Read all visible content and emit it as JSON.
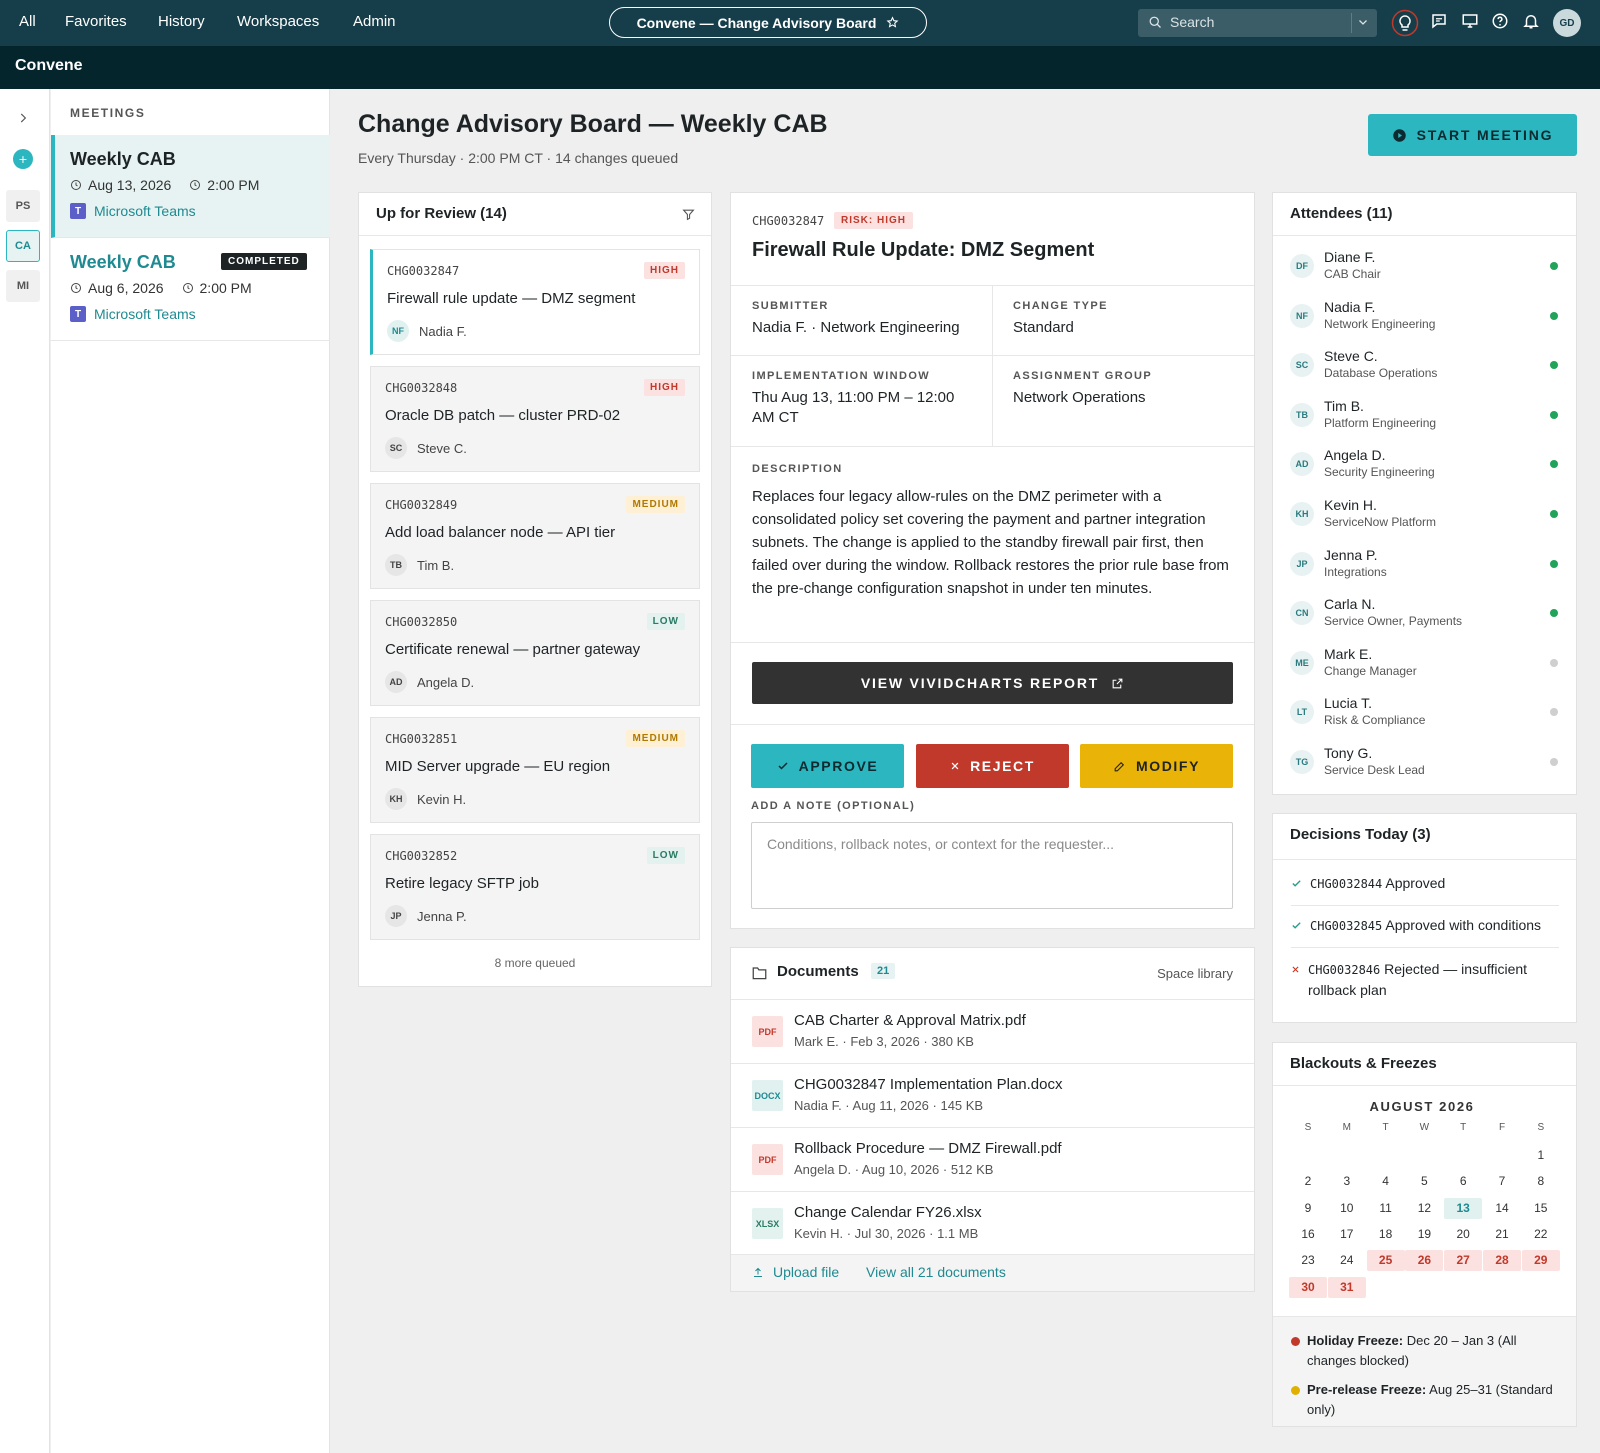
{
  "nav": {
    "items": [
      "All",
      "Favorites",
      "History",
      "Workspaces",
      "Admin"
    ],
    "workspace_title": "Convene — Change Advisory Board",
    "search_placeholder": "Search",
    "avatar_initials": "GD"
  },
  "brand": "Convene",
  "rail": {
    "items": [
      "PS",
      "CA",
      "MI"
    ],
    "active": "CA"
  },
  "meetings": {
    "label": "MEETINGS",
    "items": [
      {
        "title": "Weekly CAB",
        "date": "Aug 13, 2026",
        "time": "2:00 PM",
        "platform": "Microsoft Teams",
        "active": true
      },
      {
        "title": "Weekly CAB",
        "date": "Aug 6, 2026",
        "time": "2:00 PM",
        "platform": "Microsoft Teams",
        "status": "COMPLETED"
      }
    ]
  },
  "page": {
    "title": "Change Advisory Board — Weekly CAB",
    "subtitle": "Every Thursday · 2:00 PM CT · 14 changes queued",
    "start_button": "START MEETING"
  },
  "review": {
    "heading": "Up for Review (14)",
    "items": [
      {
        "id": "CHG0032847",
        "title": "Firewall rule update — DMZ segment",
        "risk": "HIGH",
        "initials": "NF",
        "owner": "Nadia F."
      },
      {
        "id": "CHG0032848",
        "title": "Oracle DB patch — cluster PRD-02",
        "risk": "HIGH",
        "initials": "SC",
        "owner": "Steve C."
      },
      {
        "id": "CHG0032849",
        "title": "Add load balancer node — API tier",
        "risk": "MEDIUM",
        "initials": "TB",
        "owner": "Tim B."
      },
      {
        "id": "CHG0032850",
        "title": "Certificate renewal — partner gateway",
        "risk": "LOW",
        "initials": "AD",
        "owner": "Angela D."
      },
      {
        "id": "CHG0032851",
        "title": "MID Server upgrade — EU region",
        "risk": "MEDIUM",
        "initials": "KH",
        "owner": "Kevin H."
      },
      {
        "id": "CHG0032852",
        "title": "Retire legacy SFTP job",
        "risk": "LOW",
        "initials": "JP",
        "owner": "Jenna P."
      }
    ],
    "more": "8 more queued"
  },
  "detail": {
    "id": "CHG0032847",
    "risk": "RISK: HIGH",
    "title": "Firewall Rule Update: DMZ Segment",
    "submitter_label": "SUBMITTER",
    "submitter": "Nadia F. · Network Engineering",
    "type_label": "CHANGE TYPE",
    "type": "Standard",
    "window_label": "IMPLEMENTATION WINDOW",
    "window": "Thu Aug 13, 11:00 PM – 12:00 AM CT",
    "group_label": "ASSIGNMENT GROUP",
    "group": "Network Operations",
    "desc_label": "DESCRIPTION",
    "desc": "Replaces four legacy allow-rules on the DMZ perimeter with a consolidated policy set covering the payment and partner integration subnets. The change is applied to the standby firewall pair first, then failed over during the window. Rollback restores the prior rule base from the pre-change configuration snapshot in under ten minutes.",
    "report_button": "VIEW VIVIDCHARTS REPORT",
    "approve": "APPROVE",
    "reject": "REJECT",
    "modify": "MODIFY",
    "note_label": "ADD A NOTE (OPTIONAL)",
    "note_placeholder": "Conditions, rollback notes, or context for the requester..."
  },
  "documents": {
    "heading": "Documents",
    "count": "21",
    "library": "Space library",
    "items": [
      {
        "type": "PDF",
        "name": "CAB Charter & Approval Matrix.pdf",
        "meta": "Mark E. · Feb 3, 2026 · 380 KB"
      },
      {
        "type": "DOCX",
        "name": "CHG0032847 Implementation Plan.docx",
        "meta": "Nadia F. · Aug 11, 2026 · 145 KB"
      },
      {
        "type": "PDF",
        "name": "Rollback Procedure — DMZ Firewall.pdf",
        "meta": "Angela D. · Aug 10, 2026 · 512 KB"
      },
      {
        "type": "XLSX",
        "name": "Change Calendar FY26.xlsx",
        "meta": "Kevin H. · Jul 30, 2026 · 1.1 MB"
      }
    ],
    "upload": "Upload file",
    "view_all": "View all 21 documents"
  },
  "attendees": {
    "heading": "Attendees (11)",
    "items": [
      {
        "initials": "DF",
        "name": "Diane F.",
        "role": "CAB Chair",
        "online": true
      },
      {
        "initials": "NF",
        "name": "Nadia F.",
        "role": "Network Engineering",
        "online": true
      },
      {
        "initials": "SC",
        "name": "Steve C.",
        "role": "Database Operations",
        "online": true
      },
      {
        "initials": "TB",
        "name": "Tim B.",
        "role": "Platform Engineering",
        "online": true
      },
      {
        "initials": "AD",
        "name": "Angela D.",
        "role": "Security Engineering",
        "online": true
      },
      {
        "initials": "KH",
        "name": "Kevin H.",
        "role": "ServiceNow Platform",
        "online": true
      },
      {
        "initials": "JP",
        "name": "Jenna P.",
        "role": "Integrations",
        "online": true
      },
      {
        "initials": "CN",
        "name": "Carla N.",
        "role": "Service Owner, Payments",
        "online": true
      },
      {
        "initials": "ME",
        "name": "Mark E.",
        "role": "Change Manager",
        "online": false
      },
      {
        "initials": "LT",
        "name": "Lucia T.",
        "role": "Risk & Compliance",
        "online": false
      },
      {
        "initials": "TG",
        "name": "Tony G.",
        "role": "Service Desk Lead",
        "online": false
      }
    ]
  },
  "decisions": {
    "heading": "Decisions Today (3)",
    "items": [
      {
        "id": "CHG0032844",
        "text": "Approved",
        "status": "approved"
      },
      {
        "id": "CHG0032845",
        "text": "Approved with conditions",
        "status": "approved"
      },
      {
        "id": "CHG0032846",
        "text": "Rejected — insufficient rollback plan",
        "status": "rejected"
      }
    ]
  },
  "blackouts": {
    "heading": "Blackouts & Freezes",
    "month": "AUGUST 2026",
    "weekdays": [
      "S",
      "M",
      "T",
      "W",
      "T",
      "F",
      "S"
    ],
    "first_weekday": 6,
    "days": 31,
    "today": 13,
    "freeze_days": [
      25,
      26,
      27,
      28,
      29,
      30,
      31
    ],
    "legend": [
      {
        "label": "Holiday Freeze:",
        "text": "Dec 20 – Jan 3 (All changes blocked)",
        "color": "#c0392b"
      },
      {
        "label": "Pre-release Freeze:",
        "text": "Aug 25–31 (Standard only)",
        "color": "#e0b000"
      }
    ]
  }
}
